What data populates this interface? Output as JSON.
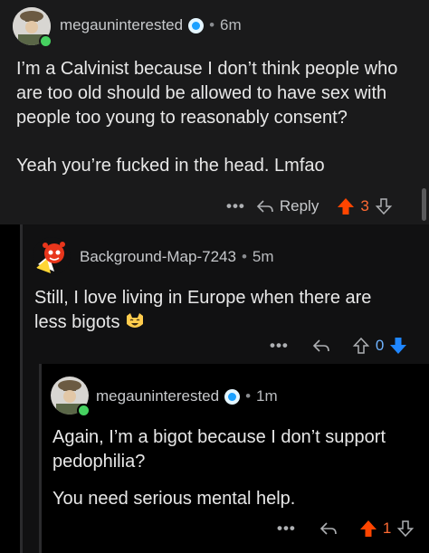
{
  "comments": [
    {
      "username": "megauninterested",
      "time": "6m",
      "body": [
        "I’m a Calvinist because I don’t think people who are too old should be allowed to have sex with people too young to reasonably consent?",
        "Yeah you’re fucked in the head. Lmfao"
      ],
      "reply_label": "Reply",
      "score": "3",
      "vote_state": "upvoted"
    },
    {
      "username": "Background-Map-7243",
      "time": "5m",
      "body": [
        "Still, I love living in Europe when there are less bigots"
      ],
      "score": "0",
      "vote_state": "downvoted"
    },
    {
      "username": "megauninterested",
      "time": "1m",
      "body": [
        "Again, I’m a bigot because I don’t support pedophilia?",
        "You need serious mental help."
      ],
      "score": "1",
      "vote_state": "upvoted"
    }
  ],
  "ui": {
    "more": "•••",
    "dot": "•"
  },
  "colors": {
    "upvote": "#ff4500",
    "downvote": "#1f86ff",
    "online": "#46d160"
  }
}
